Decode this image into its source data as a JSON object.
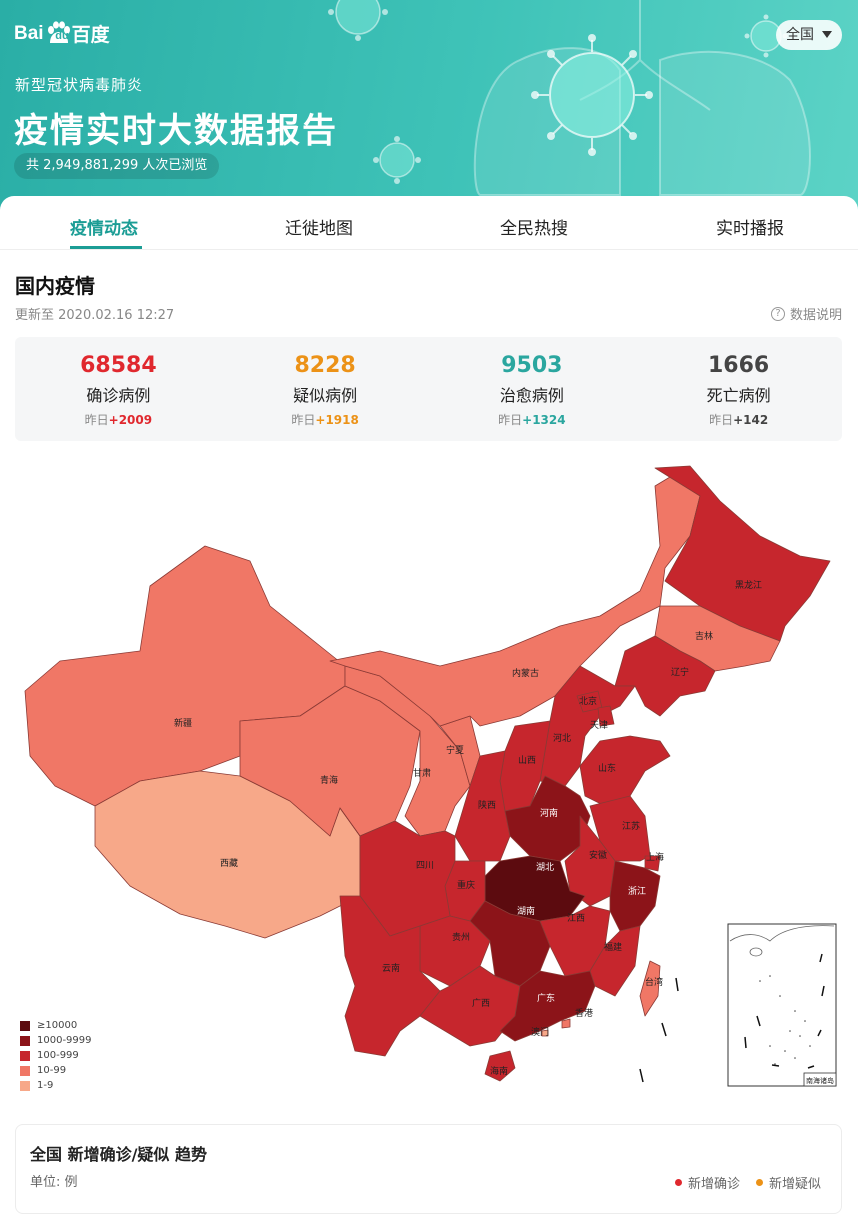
{
  "header": {
    "logo_left": "Bai",
    "logo_mid": "du",
    "logo_right": "百度",
    "subtitle": "新型冠状病毒肺炎",
    "title": "疫情实时大数据报告",
    "views_text": "共 2,949,881,299 人次已浏览",
    "region_select": "全国"
  },
  "tabs": [
    {
      "label": "疫情动态",
      "active": true
    },
    {
      "label": "迁徙地图"
    },
    {
      "label": "全民热搜"
    },
    {
      "label": "实时播报"
    }
  ],
  "domestic": {
    "title": "国内疫情",
    "update_time": "更新至 2020.02.16 12:27",
    "data_note": "数据说明",
    "stats": [
      {
        "value": "68584",
        "label": "确诊病例",
        "delta_prefix": "昨日",
        "delta": "+2009",
        "color": "#e0282e"
      },
      {
        "value": "8228",
        "label": "疑似病例",
        "delta_prefix": "昨日",
        "delta": "+1918",
        "color": "#ec9217"
      },
      {
        "value": "9503",
        "label": "治愈病例",
        "delta_prefix": "昨日",
        "delta": "+1324",
        "color": "#2aa69f"
      },
      {
        "value": "1666",
        "label": "死亡病例",
        "delta_prefix": "昨日",
        "delta": "+142",
        "color": "#444444"
      }
    ]
  },
  "map": {
    "provinces": {
      "xinjiang": {
        "name": "新疆",
        "level": "10-99"
      },
      "xizang": {
        "name": "西藏",
        "level": "1-9"
      },
      "qinghai": {
        "name": "青海",
        "level": "10-99"
      },
      "gansu": {
        "name": "甘肃",
        "level": "10-99"
      },
      "neimenggu": {
        "name": "内蒙古",
        "level": "10-99"
      },
      "ningxia": {
        "name": "宁夏",
        "level": "10-99"
      },
      "heilongjiang": {
        "name": "黑龙江",
        "level": "100-999"
      },
      "jilin": {
        "name": "吉林",
        "level": "10-99"
      },
      "liaoning": {
        "name": "辽宁",
        "level": "100-999"
      },
      "beijing": {
        "name": "北京",
        "level": "100-999"
      },
      "tianjin": {
        "name": "天津",
        "level": "100-999"
      },
      "hebei": {
        "name": "河北",
        "level": "100-999"
      },
      "shanxi": {
        "name": "山西",
        "level": "100-999"
      },
      "shandong": {
        "name": "山东",
        "level": "100-999"
      },
      "henan": {
        "name": "河南",
        "level": "1000-9999"
      },
      "shaanxi": {
        "name": "陕西",
        "level": "100-999"
      },
      "jiangsu": {
        "name": "江苏",
        "level": "100-999"
      },
      "shanghai": {
        "name": "上海",
        "level": "100-999"
      },
      "anhui": {
        "name": "安徽",
        "level": "100-999"
      },
      "hubei": {
        "name": "湖北",
        "level": "≥10000"
      },
      "zhejiang": {
        "name": "浙江",
        "level": "1000-9999"
      },
      "sichuan": {
        "name": "四川",
        "level": "100-999"
      },
      "chongqing": {
        "name": "重庆",
        "level": "100-999"
      },
      "hunan": {
        "name": "湖南",
        "level": "1000-9999"
      },
      "jiangxi": {
        "name": "江西",
        "level": "100-999"
      },
      "fujian": {
        "name": "福建",
        "level": "100-999"
      },
      "guizhou": {
        "name": "贵州",
        "level": "100-999"
      },
      "yunnan": {
        "name": "云南",
        "level": "100-999"
      },
      "guangxi": {
        "name": "广西",
        "level": "100-999"
      },
      "guangdong": {
        "name": "广东",
        "level": "1000-9999"
      },
      "hainan": {
        "name": "海南",
        "level": "100-999"
      },
      "taiwan": {
        "name": "台湾",
        "level": "10-99"
      },
      "hongkong": {
        "name": "香港",
        "level": "10-99"
      },
      "macau": {
        "name": "澳门",
        "level": "1-9"
      }
    },
    "inset_label": "南海诸岛"
  },
  "legend": [
    {
      "label": "≥10000",
      "color": "#5c0b0f"
    },
    {
      "label": "1000-9999",
      "color": "#8c1419"
    },
    {
      "label": "100-999",
      "color": "#c6262d"
    },
    {
      "label": "10-99",
      "color": "#f07766"
    },
    {
      "label": "1-9",
      "color": "#f7a889"
    }
  ],
  "trend": {
    "title": "全国 新增确诊/疑似 趋势",
    "unit": "单位: 例",
    "legend": [
      {
        "label": "新增确诊",
        "color": "#e0282e"
      },
      {
        "label": "新增疑似",
        "color": "#ec9217"
      }
    ]
  }
}
